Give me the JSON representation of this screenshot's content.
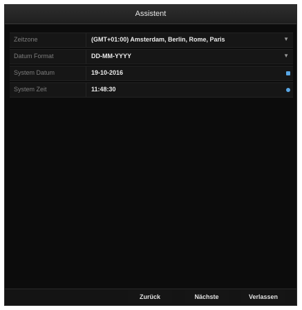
{
  "window": {
    "title": "Assistent"
  },
  "form": {
    "rows": [
      {
        "label": "Zeitzone",
        "value": "(GMT+01:00) Amsterdam, Berlin, Rome, Paris"
      },
      {
        "label": "Datum Format",
        "value": "DD-MM-YYYY"
      },
      {
        "label": "System Datum",
        "value": "19-10-2016"
      },
      {
        "label": "System Zeit",
        "value": "11:48:30"
      }
    ]
  },
  "footer": {
    "back_label": "Zurück",
    "next_label": "Nächste",
    "exit_label": "Verlassen"
  },
  "icons": {
    "calendar": "calendar-icon",
    "clock": "clock-icon",
    "dropdown": "chevron-down-icon"
  },
  "colors": {
    "accent": "#59a7e6",
    "background": "#0c0c0c"
  }
}
